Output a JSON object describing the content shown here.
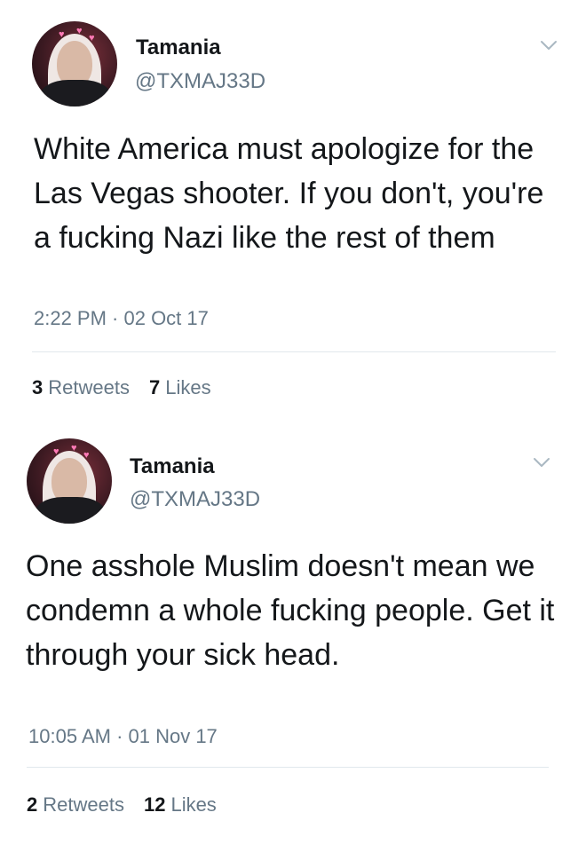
{
  "tweets": [
    {
      "display_name": "Tamania",
      "handle": "@TXMAJ33D",
      "text": "White America must apologize for the Las Vegas shooter. If you don't, you're a fucking Nazi like the rest of them",
      "timestamp": "2:22 PM · 02 Oct 17",
      "retweets_count": "3",
      "retweets_label": "Retweets",
      "likes_count": "7",
      "likes_label": "Likes",
      "icons": {
        "menu": "chevron-down-icon",
        "avatar": "profile-photo"
      }
    },
    {
      "display_name": "Tamania",
      "handle": "@TXMAJ33D",
      "text": "One asshole Muslim doesn't mean we condemn a whole fucking people. Get it through your sick head.",
      "timestamp": "10:05 AM · 01 Nov 17",
      "retweets_count": "2",
      "retweets_label": "Retweets",
      "likes_count": "12",
      "likes_label": "Likes",
      "icons": {
        "menu": "chevron-down-icon",
        "avatar": "profile-photo"
      }
    }
  ],
  "colors": {
    "text_primary": "#14171a",
    "text_secondary": "#657786",
    "divider": "#e1e8ed",
    "chevron": "#aab8c2"
  }
}
